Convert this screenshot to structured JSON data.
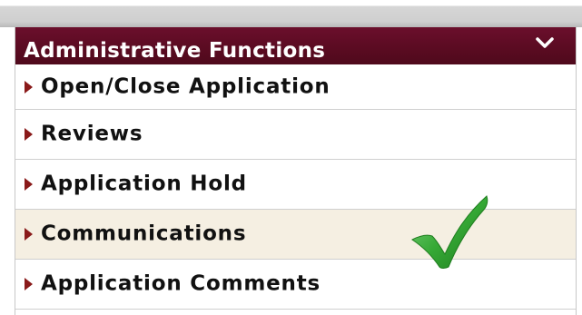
{
  "panel": {
    "title": "Administrative Functions"
  },
  "menu": {
    "items": [
      {
        "label": "Open/Close Application"
      },
      {
        "label": "Reviews"
      },
      {
        "label": "Application Hold"
      },
      {
        "label": "Communications"
      },
      {
        "label": "Application Comments"
      }
    ],
    "highlighted_item": "Communications"
  },
  "icons": {
    "header_toggle": "chevron-down-icon",
    "item_bullet": "triangle-right-icon",
    "annotation": "green-checkmark-icon"
  },
  "colors": {
    "header_bg": "#5b0b22",
    "bullet": "#8a1a1a",
    "highlight_bg": "#f5efe2",
    "checkmark": "#2f9e2f"
  }
}
